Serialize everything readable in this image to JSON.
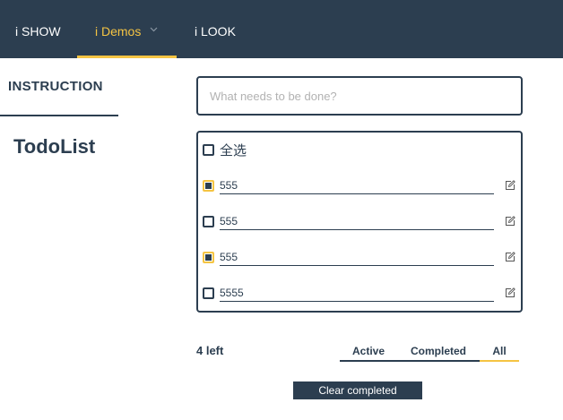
{
  "nav": {
    "items": [
      {
        "label": "i SHOW",
        "active": false
      },
      {
        "label": "i Demos",
        "active": true
      },
      {
        "label": "i LOOK",
        "active": false
      }
    ],
    "demos_icon": "chevron-down-icon",
    "colors": {
      "bar": "#2c3e50",
      "accent": "#f5c443"
    }
  },
  "sidebar": {
    "section": "INSTRUCTION",
    "page_title": "TodoList"
  },
  "new_todo": {
    "placeholder": "What needs to be done?",
    "value": ""
  },
  "select_all": {
    "label": "全选",
    "checked": false
  },
  "todos": [
    {
      "text": "555",
      "checked": true,
      "icon": "edit-icon"
    },
    {
      "text": "555",
      "checked": false,
      "icon": "edit-icon"
    },
    {
      "text": "555",
      "checked": true,
      "icon": "edit-icon"
    },
    {
      "text": "5555",
      "checked": false,
      "icon": "edit-icon"
    }
  ],
  "footer": {
    "left_count": "4 left",
    "filters": [
      {
        "label": "Active",
        "selected": false
      },
      {
        "label": "Completed",
        "selected": false
      },
      {
        "label": "All",
        "selected": true
      }
    ],
    "clear_label": "Clear completed"
  }
}
